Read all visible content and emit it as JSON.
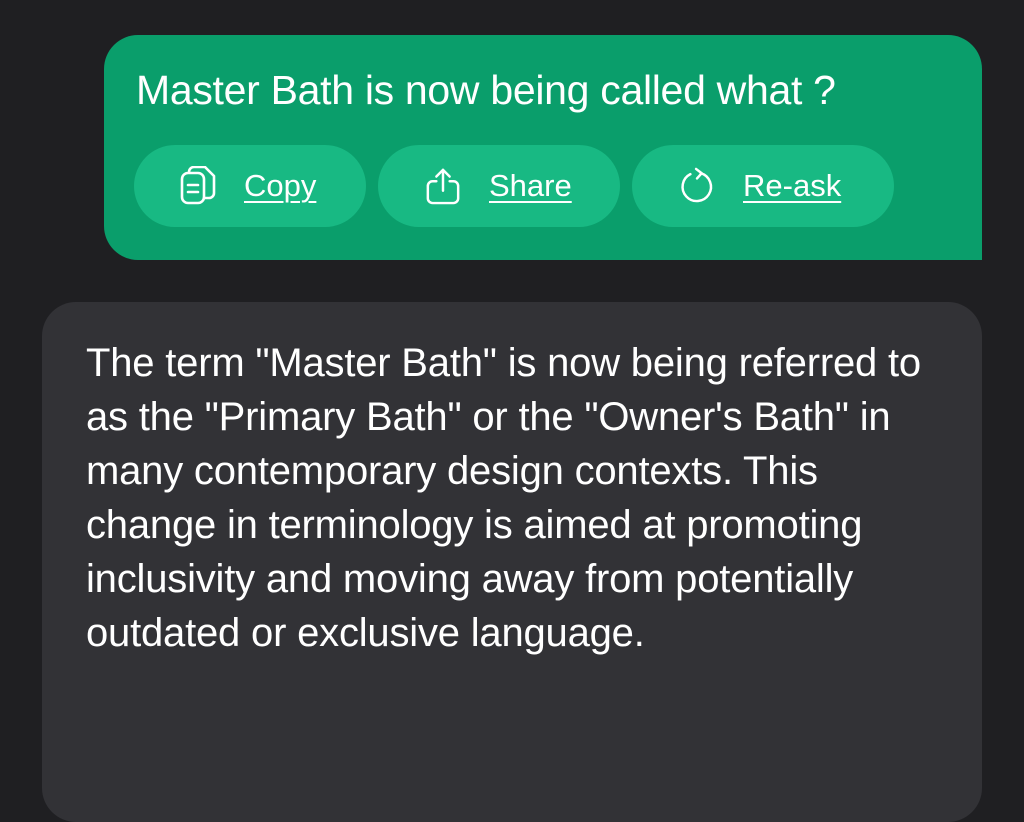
{
  "conversation": {
    "user_message": {
      "text": "Master Bath is now being called what ?",
      "actions": [
        {
          "label": "Copy",
          "icon": "copy-icon"
        },
        {
          "label": "Share",
          "icon": "share-icon"
        },
        {
          "label": "Re-ask",
          "icon": "refresh-icon"
        }
      ]
    },
    "assistant_message": {
      "text": "The term \"Master Bath\" is now being referred to as the \"Primary Bath\" or the \"Owner's Bath\" in many contemporary design contexts. This change in terminology is aimed at promoting inclusivity and moving away from potentially outdated or exclusive language."
    }
  },
  "colors": {
    "background": "#1f1f22",
    "user_bubble": "#0a9e6b",
    "action_button": "#18b983",
    "assistant_bubble": "#323236",
    "text": "#ffffff"
  }
}
